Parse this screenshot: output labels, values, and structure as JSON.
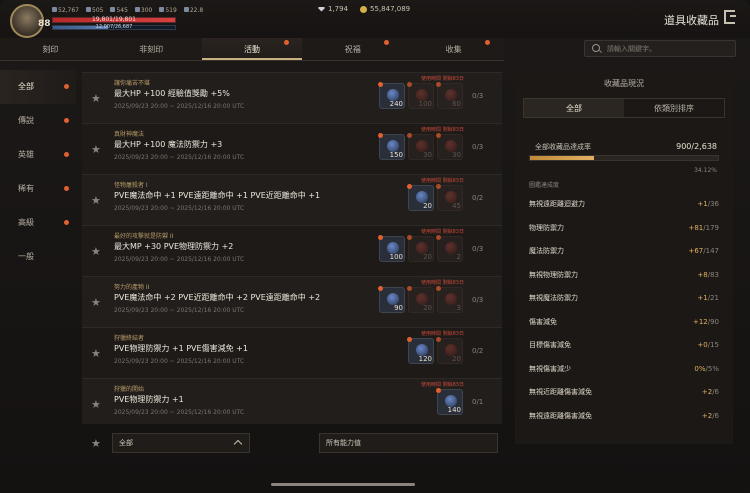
{
  "header": {
    "level": "88",
    "stats": [
      "52,767",
      "505",
      "545",
      "300",
      "519",
      "22.8"
    ],
    "hp_text": "19,801/19,801",
    "mp_text": "12,007/26,687",
    "hp_fraction": 1.0,
    "mp_fraction": 0.45,
    "gems": "1,794",
    "gold": "55,847,089",
    "title": "道具收藏品"
  },
  "tabs": [
    {
      "label": "刻印",
      "badge": false
    },
    {
      "label": "非刻印",
      "badge": false
    },
    {
      "label": "活動",
      "badge": true,
      "active": true
    },
    {
      "label": "祝福",
      "badge": true
    },
    {
      "label": "收集",
      "badge": true
    }
  ],
  "search": {
    "placeholder": "請輸入關鍵字。"
  },
  "sidebar": [
    {
      "label": "全部",
      "active": true,
      "badge": true
    },
    {
      "label": "傳說",
      "badge": true
    },
    {
      "label": "英雄",
      "badge": true
    },
    {
      "label": "稀有",
      "badge": true
    },
    {
      "label": "高級",
      "badge": true
    },
    {
      "label": "一般",
      "badge": false
    }
  ],
  "items": [
    {
      "title": "讓你痛苦不堪",
      "desc": "最大HP +100 經驗值獎勵 +5%",
      "date": "2025/09/23 20:00 ~ 2025/12/16 20:00 UTC",
      "timer": "使用時間 剩餘83日",
      "count": "0/3",
      "slots": [
        {
          "num": "240",
          "dim": false,
          "badge": true
        },
        {
          "num": "100",
          "dim": true,
          "badge": true
        },
        {
          "num": "60",
          "dim": true,
          "badge": true
        }
      ]
    },
    {
      "title": "真財神魔法",
      "desc": "最大HP +100 魔法防禦力 +3",
      "date": "2025/09/23 20:00 ~ 2025/12/16 20:00 UTC",
      "timer": "使用時間 剩餘83日",
      "count": "0/3",
      "slots": [
        {
          "num": "150",
          "dim": false,
          "badge": true
        },
        {
          "num": "30",
          "dim": true,
          "badge": true
        },
        {
          "num": "30",
          "dim": true,
          "badge": true
        }
      ]
    },
    {
      "title": "怪物屠殺者 I",
      "desc": "PVE魔法命中 +1 PVE遠距離命中 +1 PVE近距離命中 +1",
      "date": "2025/09/23 20:00 ~ 2025/12/16 20:00 UTC",
      "timer": "使用時間 剩餘83日",
      "count": "0/2",
      "slots": [
        {
          "num": "20",
          "dim": false,
          "badge": true
        },
        {
          "num": "45",
          "dim": true,
          "badge": true
        }
      ]
    },
    {
      "title": "最好的攻擊就是防禦 II",
      "desc": "最大MP +30 PVE物理防禦力 +2",
      "date": "2025/09/23 20:00 ~ 2025/12/16 20:00 UTC",
      "timer": "使用時間 剩餘83日",
      "count": "0/3",
      "slots": [
        {
          "num": "100",
          "dim": false,
          "badge": true
        },
        {
          "num": "20",
          "dim": true,
          "badge": true
        },
        {
          "num": "2",
          "dim": true,
          "badge": true
        }
      ]
    },
    {
      "title": "努力的產物 II",
      "desc": "PVE魔法命中 +2 PVE近距離命中 +2 PVE遠距離命中 +2",
      "date": "2025/09/23 20:00 ~ 2025/12/16 20:00 UTC",
      "timer": "使用時間 剩餘83日",
      "count": "0/3",
      "slots": [
        {
          "num": "90",
          "dim": false,
          "badge": true
        },
        {
          "num": "20",
          "dim": true,
          "badge": true
        },
        {
          "num": "3",
          "dim": true,
          "badge": true
        }
      ]
    },
    {
      "title": "狩獵終結者",
      "desc": "PVE物理防禦力 +1 PVE傷害減免 +1",
      "date": "2025/09/23 20:00 ~ 2025/12/16 20:00 UTC",
      "timer": "使用時間 剩餘83日",
      "count": "0/2",
      "slots": [
        {
          "num": "120",
          "dim": false,
          "badge": true
        },
        {
          "num": "20",
          "dim": true,
          "badge": true
        }
      ]
    },
    {
      "title": "狩獵的開始",
      "desc": "PVE物理防禦力 +1",
      "date": "2025/09/23 20:00 ~ 2025/12/16 20:00 UTC",
      "timer": "使用時間 剩餘83日",
      "count": "0/1",
      "slots": [
        {
          "num": "140",
          "dim": false,
          "badge": true
        }
      ]
    }
  ],
  "filters": {
    "grade": "全部",
    "ability": "所有能力值"
  },
  "panel": {
    "title": "收藏品現況",
    "tabs": [
      "全部",
      "依類別排序"
    ],
    "ach_label": "全部收藏品達成率",
    "ach_value": "900/2,638",
    "ach_fraction": 0.3412,
    "ach_pct": "34.12%",
    "book_label": "圖鑑達成度",
    "stats": [
      {
        "name": "無視遠距離迴避力",
        "plus": "+1",
        "rest": "/36"
      },
      {
        "name": "物理防禦力",
        "plus": "+81",
        "rest": "/179"
      },
      {
        "name": "魔法防禦力",
        "plus": "+67",
        "rest": "/147"
      },
      {
        "name": "無視物理防禦力",
        "plus": "+8",
        "rest": "/83"
      },
      {
        "name": "無視魔法防禦力",
        "plus": "+1",
        "rest": "/21"
      },
      {
        "name": "傷害減免",
        "plus": "+12",
        "rest": "/90"
      },
      {
        "name": "目標傷害減免",
        "plus": "+0",
        "rest": "/15"
      },
      {
        "name": "無視傷害減少",
        "plus": "0%",
        "rest": "/5%"
      },
      {
        "name": "無視近距離傷害減免",
        "plus": "+2",
        "rest": "/6"
      },
      {
        "name": "無視遠距離傷害減免",
        "plus": "+2",
        "rest": "/6"
      }
    ]
  },
  "colors": {
    "accent": "#c8b080",
    "badge": "#e06030",
    "plus": "#e0b060",
    "timer": "#c84a3a"
  }
}
